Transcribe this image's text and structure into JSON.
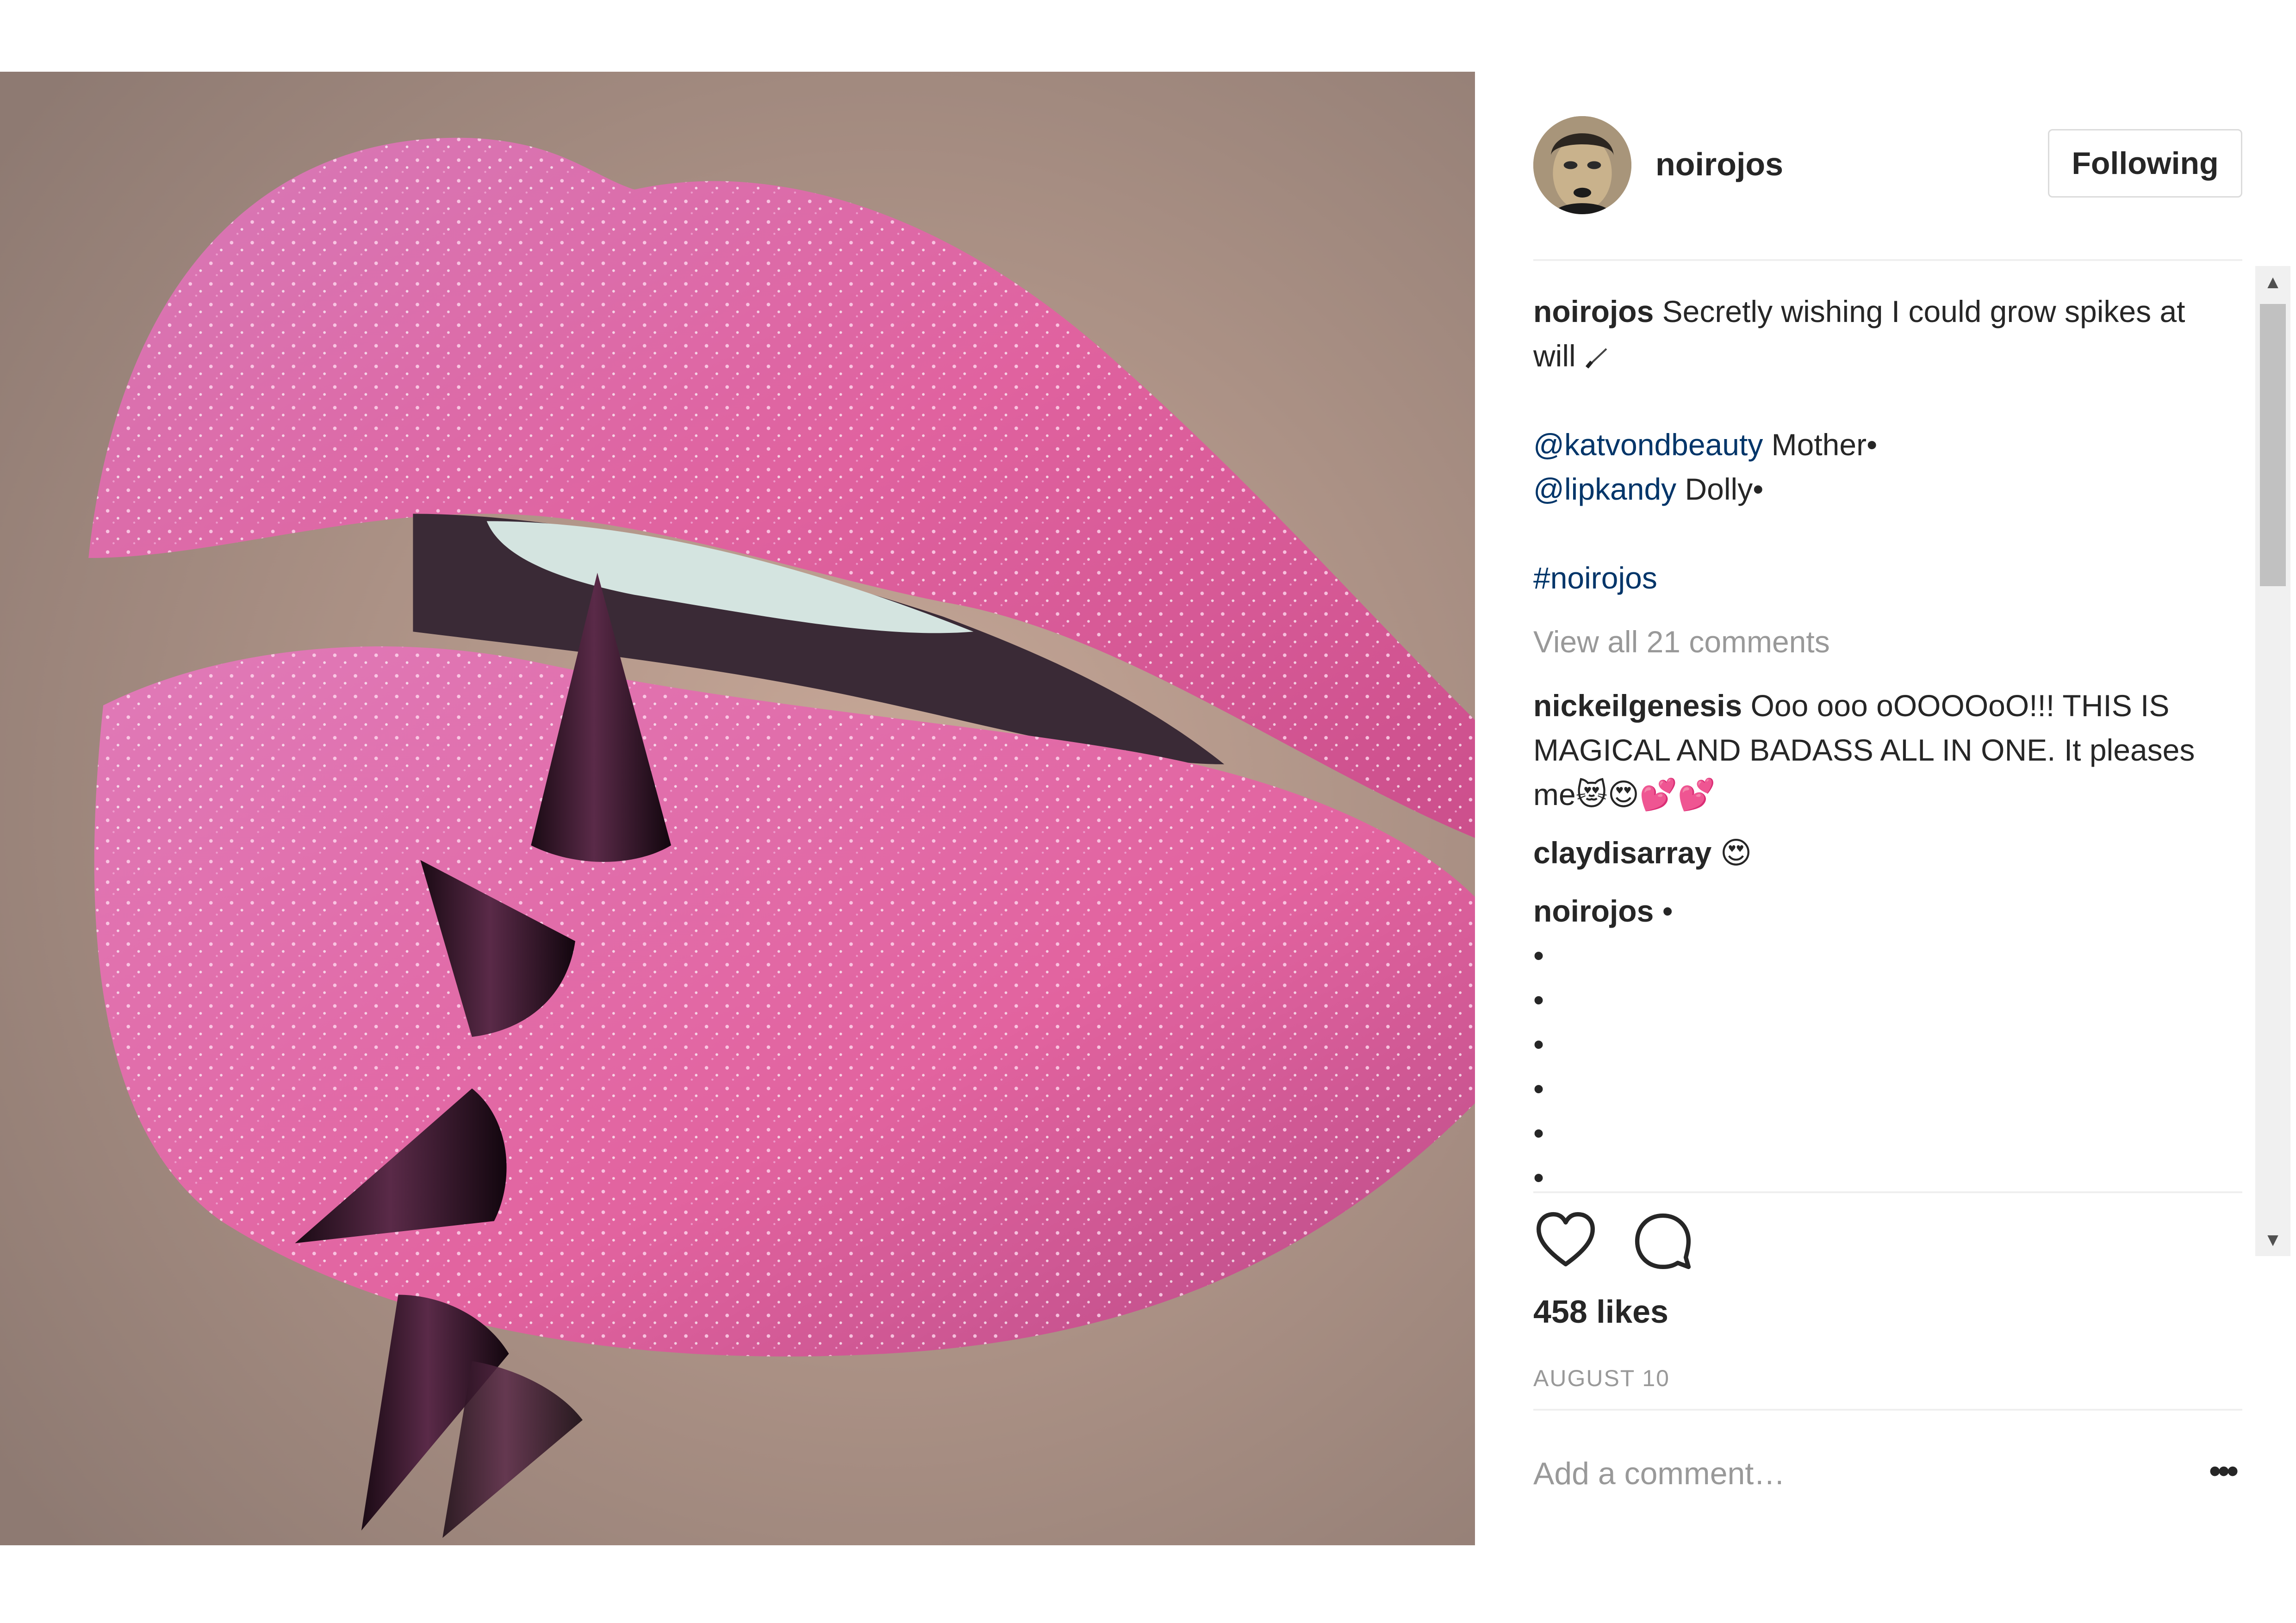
{
  "post": {
    "username": "noirojos",
    "follow_label": "Following",
    "caption_text": " Secretly wishing I could grow spikes at will ",
    "caption_icon": "brush-icon",
    "mention1": "@katvondbeauty",
    "mention1_text": " Mother•",
    "mention2": "@lipkandy",
    "mention2_text": " Dolly•",
    "hashtag": "#noirojos",
    "view_all": "View all 21 comments",
    "comments": [
      {
        "user": "nickeilgenesis",
        "text": " Ooo ooo oOOOOoO!!! THIS IS MAGICAL AND BADASS ALL IN ONE. It pleases me😻😍💕💕"
      },
      {
        "user": "claydisarray",
        "text": " 😍"
      },
      {
        "user": "noirojos",
        "text": " •"
      }
    ],
    "dots": [
      "•",
      "•",
      "•",
      "•",
      "•",
      "•"
    ],
    "likes": "458 likes",
    "date": "AUGUST 10",
    "add_comment_placeholder": "Add a comment…",
    "more_label": "•••",
    "icons": {
      "like": "heart-icon",
      "comment": "comment-bubble-icon"
    },
    "colors": {
      "link": "#003569",
      "muted": "#999999",
      "text": "#262626",
      "border": "#dbdbdb"
    }
  }
}
